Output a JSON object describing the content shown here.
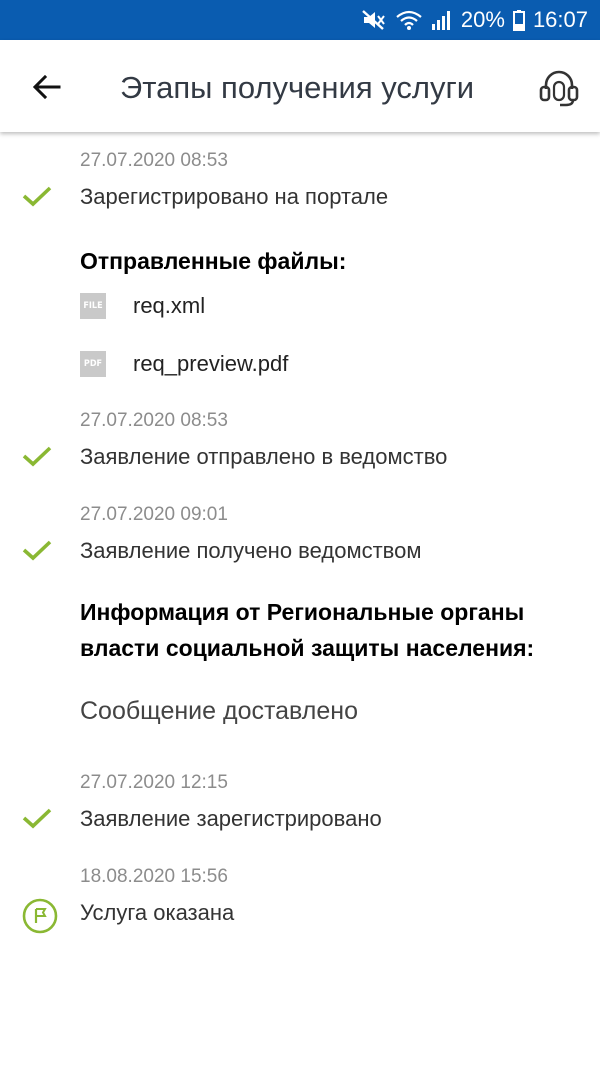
{
  "status_bar": {
    "battery_percent": "20%",
    "time": "16:07"
  },
  "header": {
    "title": "Этапы получения услуги"
  },
  "colors": {
    "status_bar": "#0a5cb0",
    "check": "#8ab833",
    "date_text": "#8c8c8c"
  },
  "steps": [
    {
      "date": "27.07.2020 08:53",
      "label": "Зарегистрировано на портале",
      "icon": "check-icon"
    },
    {
      "date": "27.07.2020 08:53",
      "label": "Заявление отправлено в ведомство",
      "icon": "check-icon"
    },
    {
      "date": "27.07.2020 09:01",
      "label": "Заявление получено ведомством",
      "icon": "check-icon"
    },
    {
      "date": "27.07.2020 12:15",
      "label": "Заявление зарегистрировано",
      "icon": "check-icon"
    },
    {
      "date": "18.08.2020 15:56",
      "label": "Услуга оказана",
      "icon": "flag-icon"
    }
  ],
  "files_section": {
    "title": "Отправленные файлы:",
    "files": [
      {
        "type": "FILE",
        "name": "req.xml"
      },
      {
        "type": "PDF",
        "name": "req_preview.pdf"
      }
    ]
  },
  "info_section": {
    "title_line1": "Информация от Региональные органы",
    "title_line2": "власти социальной защиты населения:",
    "message": "Сообщение доставлено"
  }
}
